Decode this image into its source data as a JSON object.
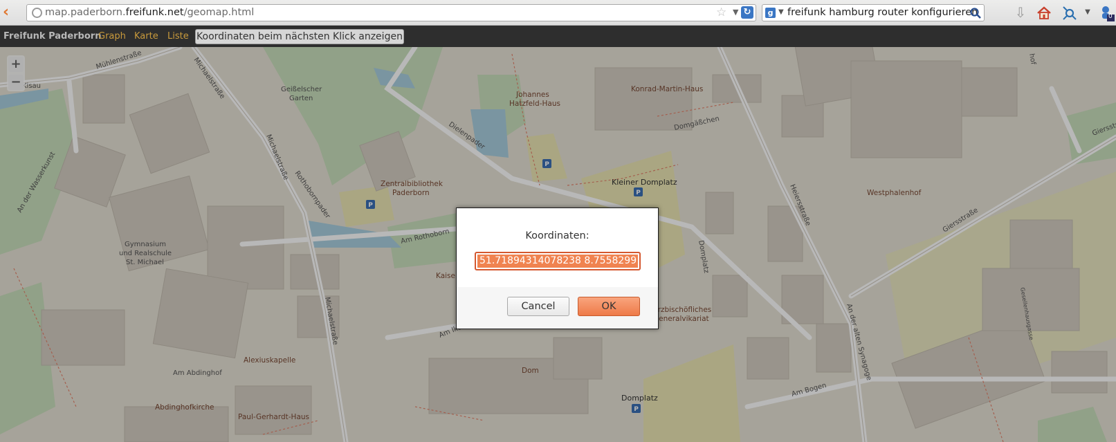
{
  "browser": {
    "url_domain_prefix": "map.paderborn.",
    "url_domain_main": "freifunk.net",
    "url_path": "/geomap.html",
    "search_text": "freifunk hamburg router konfigurieren",
    "badge_count": "0"
  },
  "navbar": {
    "brand": "Freifunk Paderborn",
    "links": [
      "Graph",
      "Karte",
      "Liste"
    ],
    "coords_button": "Koordinaten beim nächsten Klick anzeigen"
  },
  "map": {
    "zoom_in": "+",
    "zoom_out": "−",
    "labels": {
      "muehlenstrasse": "Mühlenstraße",
      "michaelstrasse_top": "Michaelstraße",
      "michaelstrasse_mid": "Michaelstraße",
      "michaelstrasse_low": "Michaelstraße",
      "rothoborn": "Rothobornpader",
      "geisselscher": "Geißelscher",
      "garten": "Garten",
      "kisau": "Kisau",
      "an_der_wasserkunst": "An der Wasserkunst",
      "gym1": "Gymnasium",
      "gym2": "und Realschule",
      "gym3": "St. Michael",
      "johannes": "Johannes",
      "hatzfeld": "Hatzfeld-Haus",
      "dielenpader": "Dielenpader",
      "zentral1": "Zentralbibliothek",
      "zentral2": "Paderborn",
      "am_rothoborn": "Am Rothoborn",
      "konrad": "Konrad-Martin-Haus",
      "domgaesschen": "Domgäßchen",
      "kleiner_domplatz": "Kleiner Domplatz",
      "domplatz_street": "Domplatz",
      "heiersstrasse": "Heiersstraße",
      "westphalenhof": "Westphalenhof",
      "giersstrasse": "Giersstraße",
      "giersstrasse2": "Giersstr",
      "an_der_alten_synagoge": "An der alten Synagoge",
      "am_ikenberg": "Am Ikenberg",
      "bisch1": "Erzbischöfliches",
      "bisch2": "Generalvikariat",
      "kaise": "Kaise",
      "alexiuskapelle": "Alexiuskapelle",
      "am_abdinghof": "Am Abdinghof",
      "dom": "Dom",
      "domplatz": "Domplatz",
      "am_bogen": "Am Bogen",
      "abdinghofkirche": "Abdinghofkirche",
      "paul_gerhardt": "Paul-Gerhardt-Haus",
      "gesellschafter": "Gesellenhausgasse",
      "hof": "hof",
      "parking": "P"
    }
  },
  "dialog": {
    "label": "Koordinaten:",
    "value": "51.71894314078238 8.7558299",
    "cancel": "Cancel",
    "ok": "OK"
  },
  "colors": {
    "accent": "#ee7a48",
    "nav_link": "#c99a3c",
    "navbar_bg": "#2e2e2e"
  }
}
